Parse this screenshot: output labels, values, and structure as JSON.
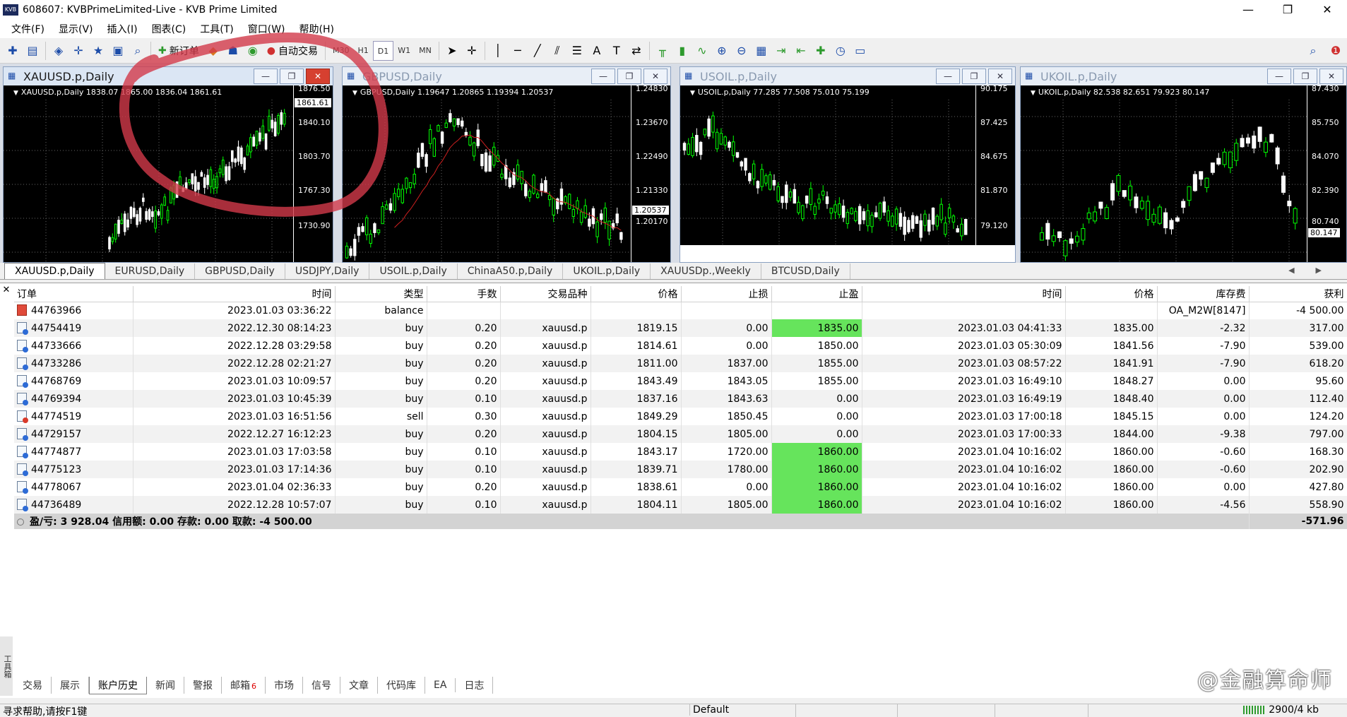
{
  "window": {
    "app_icon": "KVB",
    "title": "608607: KVBPrimeLimited-Live - KVB Prime Limited",
    "minimize": "—",
    "maximize": "❐",
    "close": "✕"
  },
  "menu": [
    "文件(F)",
    "显示(V)",
    "插入(I)",
    "图表(C)",
    "工具(T)",
    "窗口(W)",
    "帮助(H)"
  ],
  "toolbar": {
    "new_order": "新订单",
    "auto_trading": "自动交易",
    "timeframes": [
      "M30",
      "H1",
      "D1",
      "W1",
      "MN"
    ],
    "active_timeframe": "D1"
  },
  "charts": [
    {
      "title": "XAUUSD.p,Daily",
      "info": "XAUUSD.p,Daily  1838.07 1865.00 1836.04 1861.61",
      "ticks": [
        "1876.50",
        "1840.10",
        "1803.70",
        "1767.30",
        "1730.90"
      ],
      "current": "1861.61",
      "active": true
    },
    {
      "title": "GBPUSD,Daily",
      "info": "GBPUSD,Daily  1.19647 1.20865 1.19394 1.20537",
      "ticks": [
        "1.24830",
        "1.23670",
        "1.22490",
        "1.21330",
        "1.20170"
      ],
      "current": "1.20537",
      "active": false
    },
    {
      "title": "USOIL.p,Daily",
      "info": "USOIL.p,Daily  77.285 77.508 75.010 75.199",
      "ticks": [
        "90.175",
        "87.425",
        "84.675",
        "81.870",
        "79.120"
      ],
      "current": "",
      "active": false
    },
    {
      "title": "UKOIL.p,Daily",
      "info": "UKOIL.p,Daily  82.538 82.651 79.923 80.147",
      "ticks": [
        "87.430",
        "85.750",
        "84.070",
        "82.390",
        "80.740"
      ],
      "current": "80.147",
      "active": false
    }
  ],
  "chart_tabs": [
    "XAUUSD.p,Daily",
    "EURUSD,Daily",
    "GBPUSD,Daily",
    "USDJPY,Daily",
    "USOIL.p,Daily",
    "ChinaA50.p,Daily",
    "UKOIL.p,Daily",
    "XAUUSDp.,Weekly",
    "BTCUSD,Daily"
  ],
  "table": {
    "headers": [
      "订单",
      "时间",
      "类型",
      "手数",
      "交易品种",
      "价格",
      "止损",
      "止盈",
      "时间",
      "价格",
      "库存费",
      "获利"
    ],
    "rows": [
      {
        "order": "44763966",
        "open_time": "2023.01.03 03:36:22",
        "type": "balance",
        "lots": "",
        "symbol": "",
        "price": "",
        "sl": "",
        "tp": "",
        "close_time": "",
        "close_price": "",
        "swap": "OA_M2W[8147]",
        "profit": "-4 500.00",
        "tp_hit": false
      },
      {
        "order": "44754419",
        "open_time": "2022.12.30 08:14:23",
        "type": "buy",
        "lots": "0.20",
        "symbol": "xauusd.p",
        "price": "1819.15",
        "sl": "0.00",
        "tp": "1835.00",
        "close_time": "2023.01.03 04:41:33",
        "close_price": "1835.00",
        "swap": "-2.32",
        "profit": "317.00",
        "tp_hit": true
      },
      {
        "order": "44733666",
        "open_time": "2022.12.28 03:29:58",
        "type": "buy",
        "lots": "0.20",
        "symbol": "xauusd.p",
        "price": "1814.61",
        "sl": "0.00",
        "tp": "1850.00",
        "close_time": "2023.01.03 05:30:09",
        "close_price": "1841.56",
        "swap": "-7.90",
        "profit": "539.00",
        "tp_hit": false
      },
      {
        "order": "44733286",
        "open_time": "2022.12.28 02:21:27",
        "type": "buy",
        "lots": "0.20",
        "symbol": "xauusd.p",
        "price": "1811.00",
        "sl": "1837.00",
        "tp": "1855.00",
        "close_time": "2023.01.03 08:57:22",
        "close_price": "1841.91",
        "swap": "-7.90",
        "profit": "618.20",
        "tp_hit": false
      },
      {
        "order": "44768769",
        "open_time": "2023.01.03 10:09:57",
        "type": "buy",
        "lots": "0.20",
        "symbol": "xauusd.p",
        "price": "1843.49",
        "sl": "1843.05",
        "tp": "1855.00",
        "close_time": "2023.01.03 16:49:10",
        "close_price": "1848.27",
        "swap": "0.00",
        "profit": "95.60",
        "tp_hit": false
      },
      {
        "order": "44769394",
        "open_time": "2023.01.03 10:45:39",
        "type": "buy",
        "lots": "0.10",
        "symbol": "xauusd.p",
        "price": "1837.16",
        "sl": "1843.63",
        "tp": "0.00",
        "close_time": "2023.01.03 16:49:19",
        "close_price": "1848.40",
        "swap": "0.00",
        "profit": "112.40",
        "tp_hit": false
      },
      {
        "order": "44774519",
        "open_time": "2023.01.03 16:51:56",
        "type": "sell",
        "lots": "0.30",
        "symbol": "xauusd.p",
        "price": "1849.29",
        "sl": "1850.45",
        "tp": "0.00",
        "close_time": "2023.01.03 17:00:18",
        "close_price": "1845.15",
        "swap": "0.00",
        "profit": "124.20",
        "tp_hit": false
      },
      {
        "order": "44729157",
        "open_time": "2022.12.27 16:12:23",
        "type": "buy",
        "lots": "0.20",
        "symbol": "xauusd.p",
        "price": "1804.15",
        "sl": "1805.00",
        "tp": "0.00",
        "close_time": "2023.01.03 17:00:33",
        "close_price": "1844.00",
        "swap": "-9.38",
        "profit": "797.00",
        "tp_hit": false
      },
      {
        "order": "44774877",
        "open_time": "2023.01.03 17:03:58",
        "type": "buy",
        "lots": "0.10",
        "symbol": "xauusd.p",
        "price": "1843.17",
        "sl": "1720.00",
        "tp": "1860.00",
        "close_time": "2023.01.04 10:16:02",
        "close_price": "1860.00",
        "swap": "-0.60",
        "profit": "168.30",
        "tp_hit": true
      },
      {
        "order": "44775123",
        "open_time": "2023.01.03 17:14:36",
        "type": "buy",
        "lots": "0.10",
        "symbol": "xauusd.p",
        "price": "1839.71",
        "sl": "1780.00",
        "tp": "1860.00",
        "close_time": "2023.01.04 10:16:02",
        "close_price": "1860.00",
        "swap": "-0.60",
        "profit": "202.90",
        "tp_hit": true
      },
      {
        "order": "44778067",
        "open_time": "2023.01.04 02:36:33",
        "type": "buy",
        "lots": "0.20",
        "symbol": "xauusd.p",
        "price": "1838.61",
        "sl": "0.00",
        "tp": "1860.00",
        "close_time": "2023.01.04 10:16:02",
        "close_price": "1860.00",
        "swap": "0.00",
        "profit": "427.80",
        "tp_hit": true
      },
      {
        "order": "44736489",
        "open_time": "2022.12.28 10:57:07",
        "type": "buy",
        "lots": "0.10",
        "symbol": "xauusd.p",
        "price": "1804.11",
        "sl": "1805.00",
        "tp": "1860.00",
        "close_time": "2023.01.04 10:16:02",
        "close_price": "1860.00",
        "swap": "-4.56",
        "profit": "558.90",
        "tp_hit": true
      }
    ],
    "summary": "盈/亏: 3 928.04  信用额: 0.00  存款: 0.00  取款: -4 500.00",
    "summary_total": "-571.96"
  },
  "terminal_tabs": [
    "交易",
    "展示",
    "账户历史",
    "新闻",
    "警报",
    "邮箱",
    "市场",
    "信号",
    "文章",
    "代码库",
    "EA",
    "日志"
  ],
  "active_terminal_tab": "账户历史",
  "mail_badge": "6",
  "side_label": "工具箱",
  "watermark": "@金融算命师",
  "status": {
    "help": "寻求帮助,请按F1键",
    "profile": "Default",
    "traffic": "2900/4 kb"
  },
  "colors": {
    "tp_hit": "#66e45c",
    "annotation": "#d23a4a",
    "bull_candle": "#00ff00",
    "bear_candle": "#ffffff"
  },
  "icons": {
    "search": "search-icon",
    "alert": "alert-icon"
  }
}
